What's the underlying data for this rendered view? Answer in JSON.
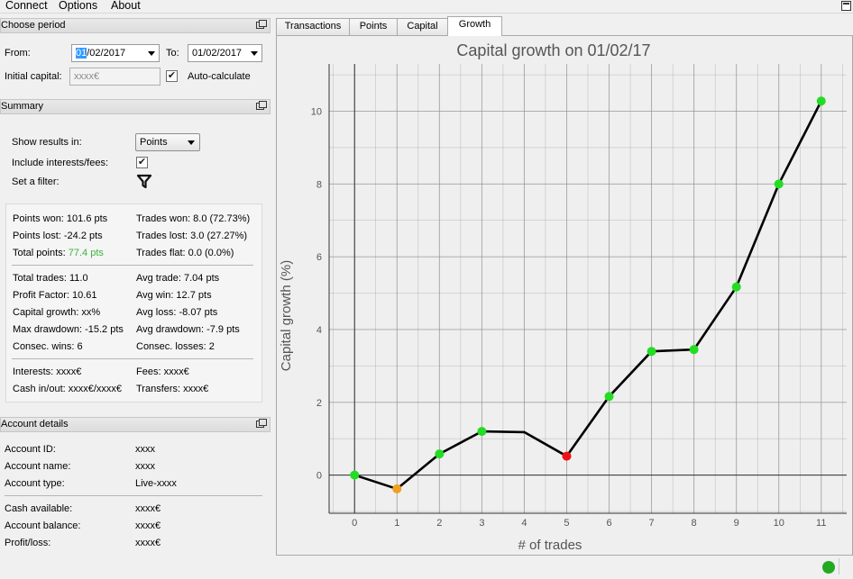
{
  "menu": {
    "items": [
      "Connect",
      "Options",
      "About"
    ]
  },
  "choose_period": {
    "title": "Choose period",
    "from_label": "From:",
    "from_selected": "01",
    "from_rest": "/02/2017",
    "to_label": "To:",
    "to_value": "01/02/2017",
    "initial_capital_label": "Initial capital:",
    "initial_capital_placeholder": "xxxx€",
    "auto_calculate_label": "Auto-calculate",
    "auto_calculate_checked": true
  },
  "summary": {
    "title": "Summary",
    "show_results_label": "Show results in:",
    "show_results_value": "Points",
    "include_interests_label": "Include interests/fees:",
    "include_interests_checked": true,
    "set_filter_label": "Set a filter:",
    "stats": {
      "points_won": "Points won: 101.6 pts",
      "trades_won": "Trades won: 8.0 (72.73%)",
      "points_lost": "Points lost: -24.2 pts",
      "trades_lost": "Trades lost: 3.0 (27.27%)",
      "total_points_label": "Total points:",
      "total_points_value": "77.4 pts",
      "total_points_color": "#3cb33c",
      "trades_flat": "Trades flat: 0.0 (0.0%)",
      "total_trades": "Total trades: 11.0",
      "avg_trade": "Avg trade: 7.04 pts",
      "profit_factor": "Profit Factor: 10.61",
      "avg_win": "Avg win: 12.7 pts",
      "capital_growth": "Capital growth: xx%",
      "avg_loss": "Avg loss: -8.07 pts",
      "max_drawdown": "Max drawdown: -15.2 pts",
      "avg_drawdown": "Avg drawdown: -7.9 pts",
      "consec_wins": "Consec. wins: 6",
      "consec_losses": "Consec. losses: 2",
      "interests": "Interests: xxxx€",
      "fees": "Fees: xxxx€",
      "cash_in_out": "Cash in/out: xxxx€/xxxx€",
      "transfers": "Transfers: xxxx€"
    }
  },
  "account": {
    "title": "Account details",
    "rows": [
      {
        "label": "Account ID:",
        "value": "xxxx"
      },
      {
        "label": "Account name:",
        "value": "xxxx"
      },
      {
        "label": "Account type:",
        "value": "Live-xxxx"
      },
      {
        "label": "Cash available:",
        "value": "xxxx€"
      },
      {
        "label": "Account balance:",
        "value": "xxxx€"
      },
      {
        "label": "Profit/loss:",
        "value": "xxxx€"
      }
    ]
  },
  "tabs": [
    {
      "label": "Transactions",
      "active": false
    },
    {
      "label": "Points",
      "active": false
    },
    {
      "label": "Capital",
      "active": false
    },
    {
      "label": "Growth",
      "active": true
    }
  ],
  "status": {
    "connection_color": "#22aa22"
  },
  "chart_data": {
    "type": "line",
    "title": "Capital growth on 01/02/17",
    "xlabel": "# of trades",
    "ylabel": "Capital growth (%)",
    "x": [
      0,
      1,
      2,
      3,
      4,
      5,
      6,
      7,
      8,
      9,
      10,
      11
    ],
    "y": [
      0.0,
      -0.38,
      0.58,
      1.2,
      1.18,
      0.52,
      2.16,
      3.4,
      3.45,
      5.17,
      8.0,
      10.28
    ],
    "point_colors": [
      "#22dd22",
      "#f0a020",
      "#22dd22",
      "#22dd22",
      null,
      "#ee1111",
      "#22dd22",
      "#22dd22",
      "#22dd22",
      "#22dd22",
      "#22dd22",
      "#22dd22"
    ],
    "xlim": [
      -0.6,
      11.6
    ],
    "ylim": [
      -1.05,
      11.3
    ],
    "xticks": [
      0,
      1,
      2,
      3,
      4,
      5,
      6,
      7,
      8,
      9,
      10,
      11
    ],
    "yticks": [
      0,
      2,
      4,
      6,
      8,
      10
    ],
    "grid": true,
    "line_color": "#000000",
    "background": "#efefef",
    "grid_color": "#8c8c8c"
  }
}
